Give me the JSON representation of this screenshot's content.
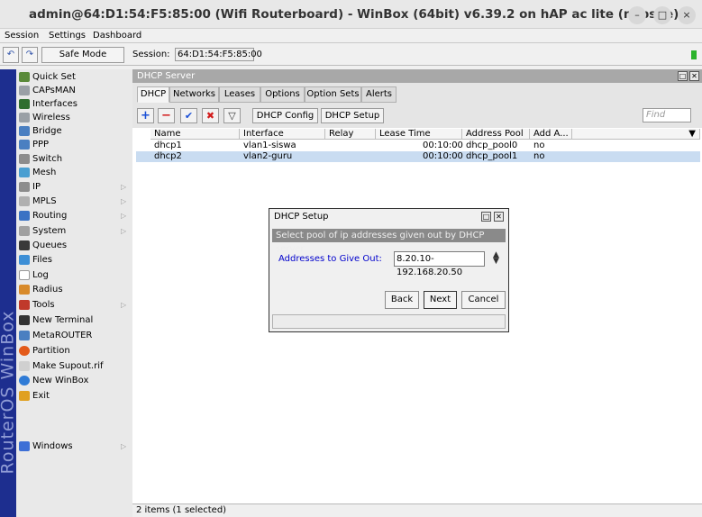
{
  "window": {
    "title": "admin@64:D1:54:F5:85:00 (Wifi Routerboard) - WinBox (64bit) v6.39.2 on hAP ac lite (mipsbe)",
    "min": "–",
    "max": "□",
    "close": "×"
  },
  "menu": [
    "Session",
    "Settings",
    "Dashboard"
  ],
  "toolbar": {
    "safe_mode": "Safe Mode",
    "session_label": "Session:",
    "session_value": "64:D1:54:F5:85:00",
    "undo": "↶",
    "redo": "↷"
  },
  "brand": "RouterOS WinBox",
  "sidebar": {
    "items": [
      {
        "label": "Quick Set",
        "color": "#5a8a3a"
      },
      {
        "label": "CAPsMAN",
        "color": "#9aa0a6"
      },
      {
        "label": "Interfaces",
        "color": "#2f6e2f"
      },
      {
        "label": "Wireless",
        "color": "#9aa0a6"
      },
      {
        "label": "Bridge",
        "color": "#4a7fc1"
      },
      {
        "label": "PPP",
        "color": "#4a7fc1"
      },
      {
        "label": "Switch",
        "color": "#8c8c8c"
      },
      {
        "label": "Mesh",
        "color": "#4a9fd1"
      },
      {
        "label": "IP",
        "color": "#8c8c8c"
      },
      {
        "label": "MPLS",
        "color": "#b0b0b0"
      },
      {
        "label": "Routing",
        "color": "#3a72c4"
      },
      {
        "label": "System",
        "color": "#a0a0a0"
      },
      {
        "label": "Queues",
        "color": "#3a3a3a"
      },
      {
        "label": "Files",
        "color": "#3d8fd6"
      },
      {
        "label": "Log",
        "color": "#ffffff"
      },
      {
        "label": "Radius",
        "color": "#d88a2a"
      },
      {
        "label": "Tools",
        "color": "#c0392b"
      },
      {
        "label": "New Terminal",
        "color": "#333333"
      },
      {
        "label": "MetaROUTER",
        "color": "#4a7fc1"
      },
      {
        "label": "Partition",
        "color": "#e35a1a"
      },
      {
        "label": "Make Supout.rif",
        "color": "#d0d0d0"
      },
      {
        "label": "New WinBox",
        "color": "#2f7bd6"
      },
      {
        "label": "Exit",
        "color": "#e0a020"
      },
      {
        "label": "Windows",
        "color": "#3d6fd6"
      }
    ],
    "submenu_arrow": "▷"
  },
  "dhcp_window": {
    "title": "DHCP Server",
    "tabs": [
      "DHCP",
      "Networks",
      "Leases",
      "Options",
      "Option Sets",
      "Alerts"
    ],
    "buttons": {
      "add": "+",
      "remove": "−",
      "enable": "✔",
      "disable": "✖",
      "filter": "▽",
      "dhcp_config": "DHCP Config",
      "dhcp_setup": "DHCP Setup"
    },
    "find_placeholder": "Find",
    "columns": [
      "Name",
      "Interface",
      "Relay",
      "Lease Time",
      "Address Pool",
      "Add A..."
    ],
    "rows": [
      {
        "name": "dhcp1",
        "interface": "vlan1-siswa",
        "relay": "",
        "lease_time": "00:10:00",
        "address_pool": "dhcp_pool0",
        "add_arp": "no"
      },
      {
        "name": "dhcp2",
        "interface": "vlan2-guru",
        "relay": "",
        "lease_time": "00:10:00",
        "address_pool": "dhcp_pool1",
        "add_arp": "no"
      }
    ],
    "status": "2 items (1 selected)"
  },
  "dialog": {
    "title": "DHCP Setup",
    "subtitle": "Select pool of ip addresses given out by DHCP server",
    "field_label": "Addresses to Give Out:",
    "field_value": "8.20.10-192.168.20.50",
    "back": "Back",
    "next": "Next",
    "cancel": "Cancel"
  }
}
